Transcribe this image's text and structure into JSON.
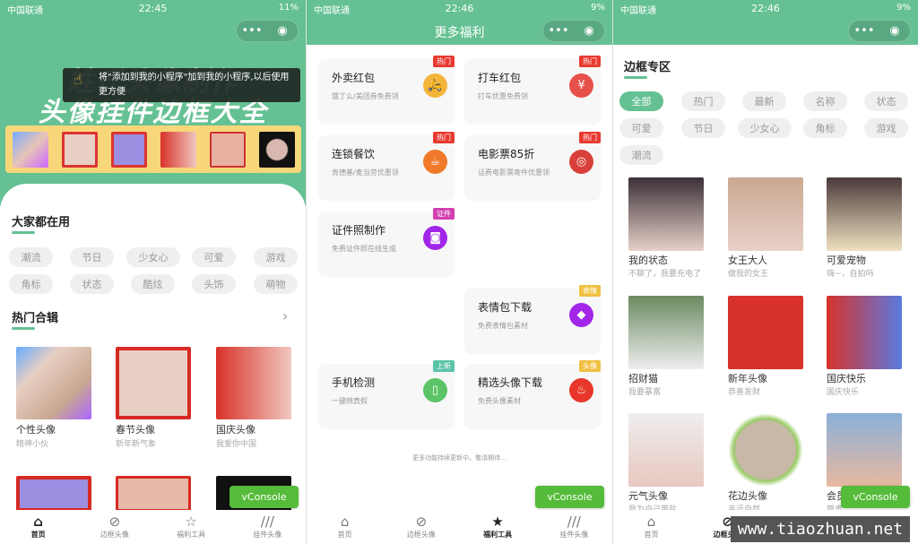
{
  "colors": {
    "brand": "#65c193",
    "hot": "#e83a30",
    "vconsole": "#55bb3a"
  },
  "screens": [
    {
      "status": {
        "carrier": "中国联通",
        "time": "22:45",
        "battery": "11%"
      },
      "capsule": {
        "more": "•••",
        "close": "◉"
      },
      "banner": {
        "line1": "姓氏头像制作",
        "line2": "头像挂件边框大全"
      },
      "tooltip": "将\"添加到我的小程序\"加到我的小程序,以后使用更方便",
      "section1": "大家都在用",
      "tags": [
        "潮流",
        "节日",
        "少女心",
        "可爱",
        "游戏",
        "角标",
        "状态",
        "酷炫",
        "头饰",
        "萌物"
      ],
      "section2": "热门合辑",
      "items": [
        {
          "title": "个性头像",
          "sub": "精神小伙"
        },
        {
          "title": "春节头像",
          "sub": "新年新气象"
        },
        {
          "title": "国庆头像",
          "sub": "我爱你中国"
        }
      ],
      "vconsole": "vConsole"
    },
    {
      "status": {
        "carrier": "中国联通",
        "time": "22:46",
        "battery": "9%"
      },
      "title": "更多福利",
      "cards": [
        {
          "title": "外卖红包",
          "desc": "饿了么/美团券免费领",
          "badge": "热门",
          "icon": "scooter-icon",
          "color": "#f2b53a",
          "badge_color": "#e83a30"
        },
        {
          "title": "打车红包",
          "desc": "打车优惠免费领",
          "badge": "热门",
          "icon": "yuan-ticket-icon",
          "color": "#e8504a",
          "badge_color": "#e83a30"
        },
        {
          "title": "连锁餐饮",
          "desc": "肯德基/麦当劳优惠领",
          "badge": "热门",
          "icon": "coffee-icon",
          "color": "#f07a2a",
          "badge_color": "#e83a30"
        },
        {
          "title": "电影票85折",
          "desc": "话费电影票寄件优惠领",
          "badge": "热门",
          "icon": "film-reel-icon",
          "color": "#d9403a",
          "badge_color": "#e83a30"
        },
        {
          "title": "证件照制作",
          "desc": "免费证件照在线生成",
          "badge": "证件",
          "icon": "camera-icon",
          "color": "#a226e8",
          "badge_color": "#d23fb0"
        },
        {
          "title": "表情包下载",
          "desc": "免费表情包素材",
          "badge": "表情",
          "icon": "diamond-icon",
          "color": "#a226e8",
          "badge_color": "#f0c040"
        },
        {
          "title": "手机检测",
          "desc": "一键辨真假",
          "badge": "上新",
          "icon": "phone-icon",
          "color": "#5cc466",
          "badge_color": "#5cc4a8"
        },
        {
          "title": "精选头像下载",
          "desc": "免费头像素材",
          "badge": "头像",
          "icon": "flame-icon",
          "color": "#e8362a",
          "badge_color": "#f0c040"
        }
      ],
      "footer": "更多功能持续更新中，敬请期待...",
      "vconsole": "vConsole"
    },
    {
      "status": {
        "carrier": "中国联通",
        "time": "22:46",
        "battery": "9%"
      },
      "section": "边框专区",
      "tags": [
        "全部",
        "热门",
        "最新",
        "名称",
        "状态",
        "可爱",
        "节日",
        "少女心",
        "角标",
        "游戏",
        "潮流"
      ],
      "active_tag": "全部",
      "items": [
        {
          "title": "我的状态",
          "sub": "不聊了，我要充电了"
        },
        {
          "title": "女王大人",
          "sub": "做我的女王"
        },
        {
          "title": "可爱宠物",
          "sub": "嗨~，自拍吗"
        },
        {
          "title": "招财猫",
          "sub": "我要暴富"
        },
        {
          "title": "新年头像",
          "sub": "恭喜发财"
        },
        {
          "title": "国庆快乐",
          "sub": "国庆快乐"
        },
        {
          "title": "元气头像",
          "sub": "我为自己带盐"
        },
        {
          "title": "花边头像",
          "sub": "亲近自然"
        },
        {
          "title": "会员头像",
          "sub": "尊贵"
        }
      ],
      "vconsole": "vConsole",
      "watermark": "www.tiaozhuan.net"
    }
  ],
  "tabbar": [
    {
      "label": "首页",
      "icon": "home-icon"
    },
    {
      "label": "边框头像",
      "icon": "compass-icon"
    },
    {
      "label": "福利工具",
      "icon": "star-icon"
    },
    {
      "label": "挂件头像",
      "icon": "slashes-icon"
    }
  ]
}
